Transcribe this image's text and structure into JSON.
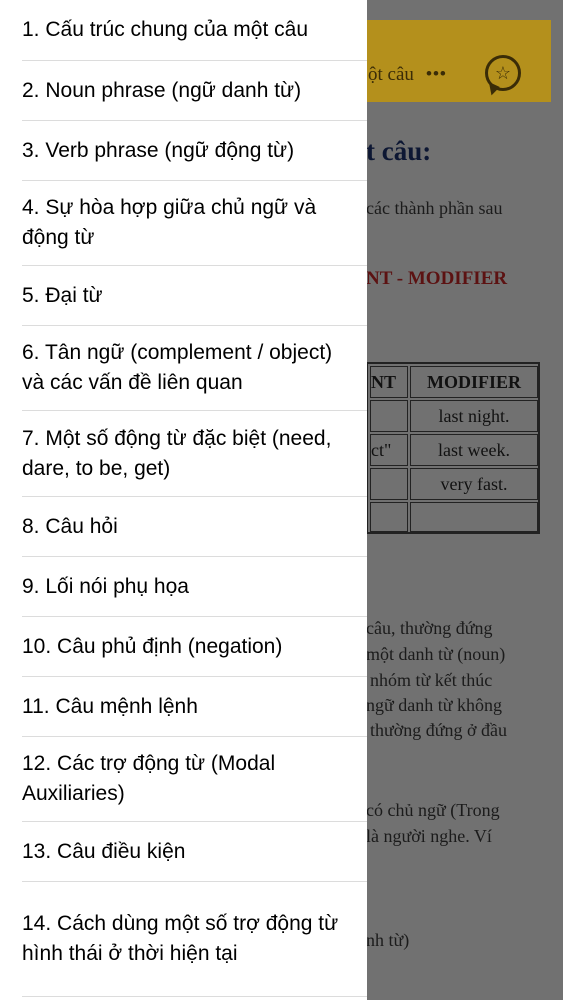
{
  "background": {
    "header_title_fragment": "ột câu",
    "header_dots": "•••",
    "heading_fragment": "t câu:",
    "paragraph_fragment": "các thành phần sau",
    "red_fragment": "NT - MODIFIER",
    "table": {
      "header": [
        "NT",
        "MODIFIER"
      ],
      "rows": [
        [
          "",
          "last night."
        ],
        [
          "ct\"",
          "last week."
        ],
        [
          "",
          "very fast."
        ],
        [
          "",
          ""
        ]
      ]
    },
    "body_lines": [
      "câu, thường đứng",
      "một danh từ (noun)",
      "nhóm từ kết thúc",
      "ngữ danh từ không",
      "thường đứng ở đầu",
      "có chủ ngữ (Trong",
      "là người nghe. Ví",
      "nh từ)"
    ]
  },
  "menu": {
    "items": [
      "1. Cấu trúc chung của một câu",
      "2. Noun phrase (ngữ danh từ)",
      "3. Verb phrase (ngữ động từ)",
      "4. Sự hòa hợp giữa chủ ngữ và động từ",
      "5. Đại từ",
      "6. Tân ngữ (complement / object) và các vấn đề liên quan",
      "7. Một số động từ đặc biệt (need, dare, to be, get)",
      "8. Câu hỏi",
      "9. Lối nói phụ họa",
      "10. Câu phủ định (negation)",
      "11. Câu mệnh lệnh",
      "12. Các trợ động từ (Modal Auxiliaries)",
      "13. Câu điều kiện",
      "14. Cách dùng một số trợ động từ hình thái ở thời hiện tại"
    ]
  }
}
